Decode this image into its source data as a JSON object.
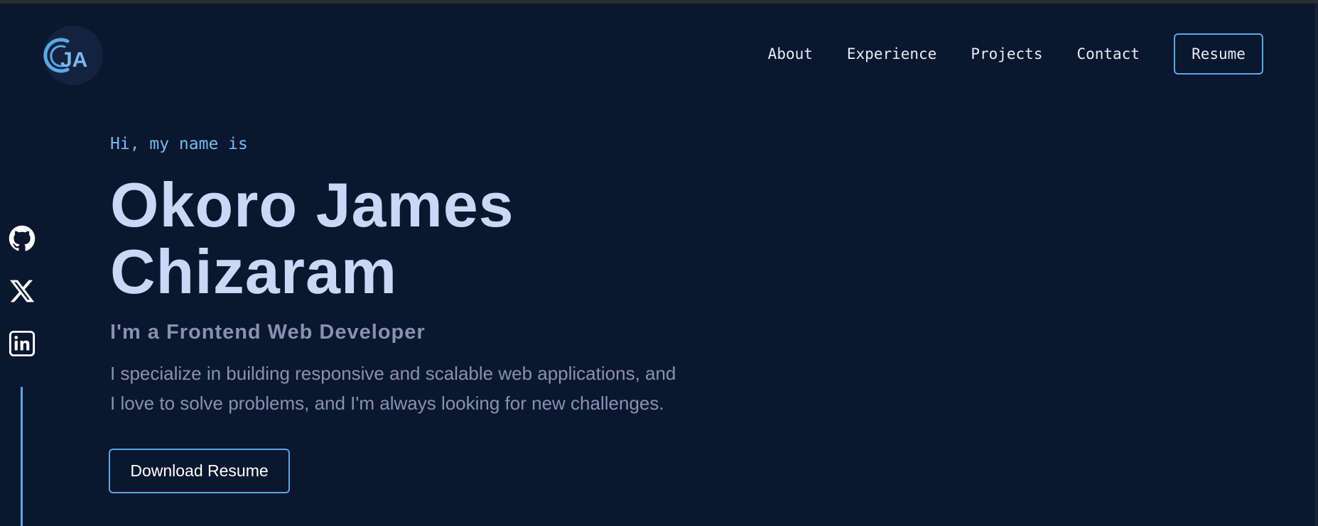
{
  "logo": {
    "icon": "ja-monogram-logo",
    "letters": "JA"
  },
  "nav": {
    "links": [
      "About",
      "Experience",
      "Projects",
      "Contact"
    ],
    "resume_label": "Resume"
  },
  "social": {
    "icons": [
      "github-icon",
      "x-twitter-icon",
      "linkedin-icon"
    ]
  },
  "hero": {
    "greeting": "Hi, my name is",
    "name_line1": "Okoro James",
    "name_line2": "Chizaram",
    "role": "I'm a Frontend Web Developer",
    "bio_line1": "I specialize in building responsive and scalable web applications, and",
    "bio_line2": "I love to solve problems, and I'm always looking for new challenges.",
    "cta_label": "Download Resume"
  },
  "colors": {
    "background": "#0b172e",
    "accent": "#5aa8e6",
    "heading": "#ccd6f6",
    "muted": "#8892b0",
    "greeting": "#7ab8ef"
  }
}
